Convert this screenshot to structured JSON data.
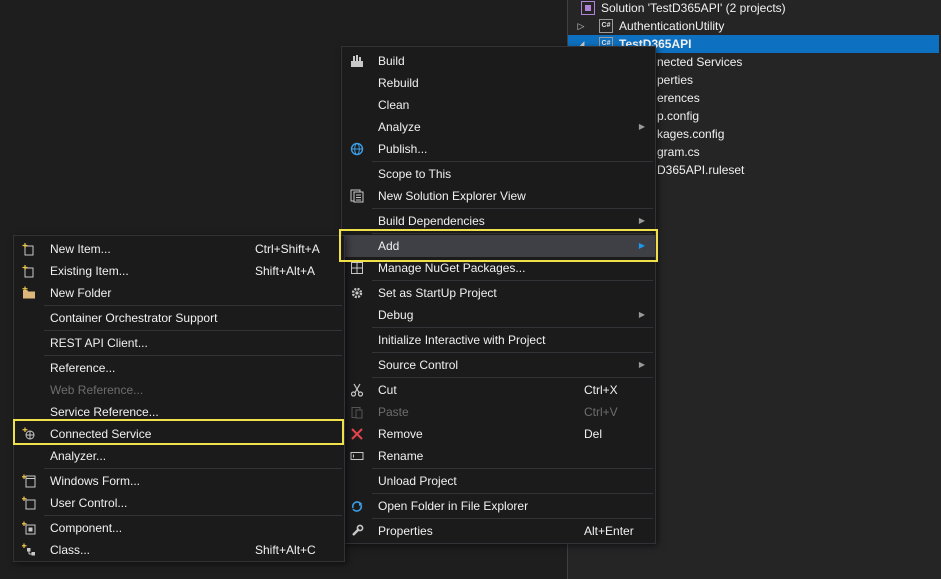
{
  "solution_explorer": {
    "solution_label": "Solution 'TestD365API' (2 projects)",
    "project_authentication": "AuthenticationUtility",
    "project_selected": "TestD365API",
    "children": [
      "nected Services",
      "perties",
      "erences",
      "p.config",
      "kages.config",
      "gram.cs",
      "D365API.ruleset"
    ]
  },
  "context_menu": {
    "build": "Build",
    "rebuild": "Rebuild",
    "clean": "Clean",
    "analyze": "Analyze",
    "publish": "Publish...",
    "scope_to_this": "Scope to This",
    "new_solution_explorer_view": "New Solution Explorer View",
    "build_dependencies": "Build Dependencies",
    "add": "Add",
    "manage_nuget": "Manage NuGet Packages...",
    "set_startup": "Set as StartUp Project",
    "debug": "Debug",
    "initialize_interactive": "Initialize Interactive with Project",
    "source_control": "Source Control",
    "cut": "Cut",
    "cut_shortcut": "Ctrl+X",
    "paste": "Paste",
    "paste_shortcut": "Ctrl+V",
    "remove": "Remove",
    "remove_shortcut": "Del",
    "rename": "Rename",
    "unload_project": "Unload Project",
    "open_folder": "Open Folder in File Explorer",
    "properties": "Properties",
    "properties_shortcut": "Alt+Enter"
  },
  "add_submenu": {
    "new_item": "New Item...",
    "new_item_shortcut": "Ctrl+Shift+A",
    "existing_item": "Existing Item...",
    "existing_item_shortcut": "Shift+Alt+A",
    "new_folder": "New Folder",
    "container_orchestrator": "Container Orchestrator Support",
    "rest_api_client": "REST API Client...",
    "reference": "Reference...",
    "web_reference": "Web Reference...",
    "service_reference": "Service Reference...",
    "connected_service": "Connected Service",
    "analyzer": "Analyzer...",
    "windows_form": "Windows Form...",
    "user_control": "User Control...",
    "component": "Component...",
    "class": "Class...",
    "class_shortcut": "Shift+Alt+C"
  },
  "colors": {
    "highlight_box": "#f0e04a",
    "selection_blue": "#0e70c0",
    "menu_bg": "#1b1b1c",
    "editor_bg": "#1e1e1e"
  }
}
